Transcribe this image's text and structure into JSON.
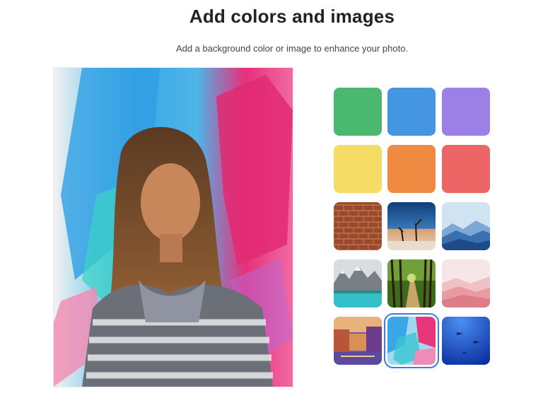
{
  "header": {
    "title": "Add colors and images",
    "subtitle": "Add a background color or image to enhance your photo."
  },
  "preview": {
    "image": "woman-in-blanket-over-painted-backdrop"
  },
  "swatches": [
    {
      "kind": "color",
      "color": "#4ab86f"
    },
    {
      "kind": "color",
      "color": "#4496e0"
    },
    {
      "kind": "color",
      "color": "#9d80e6"
    },
    {
      "kind": "color",
      "color": "#f5dd65"
    },
    {
      "kind": "color",
      "color": "#ee8a42"
    },
    {
      "kind": "color",
      "color": "#ee6565"
    },
    {
      "kind": "image",
      "image": "brick-wall"
    },
    {
      "kind": "image",
      "image": "desert-trees"
    },
    {
      "kind": "image",
      "image": "blue-mountains"
    },
    {
      "kind": "image",
      "image": "mountain-lake"
    },
    {
      "kind": "image",
      "image": "forest-path"
    },
    {
      "kind": "image",
      "image": "pink-hills"
    },
    {
      "kind": "image",
      "image": "venice-canal"
    },
    {
      "kind": "image",
      "image": "abstract-paint",
      "selected": true
    },
    {
      "kind": "image",
      "image": "underwater-sharks"
    }
  ]
}
